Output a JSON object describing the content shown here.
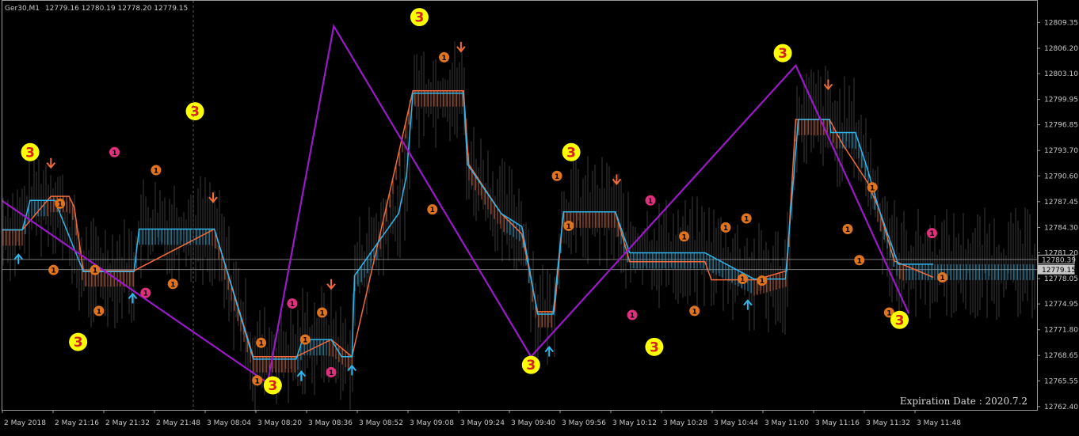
{
  "header": {
    "symbol": "Ger30,M1",
    "ohlc": "12779.16 12780.19 12778.20 12779.15"
  },
  "footer": {
    "expiration": "Expiration Date : 2020.7.2"
  },
  "colors": {
    "background": "#000000",
    "frame": "#9a9a9a",
    "candles": "#3a3a3a",
    "zigzag": "#9a19c8",
    "bull": "#2fb6ec",
    "bear": "#f26b3a",
    "dot_orange": "#e0741e",
    "dot_pink": "#e02f7c",
    "badge_fill": "#ffff00",
    "badge_text": "#d61f1f",
    "price_line": "#7a7a7a"
  },
  "chart_data": {
    "type": "line",
    "x_ticks": [
      "2 May 2018",
      "2 May 21:16",
      "2 May 21:32",
      "2 May 21:48",
      "3 May 08:04",
      "3 May 08:20",
      "3 May 08:36",
      "3 May 08:52",
      "3 May 09:08",
      "3 May 09:24",
      "3 May 09:40",
      "3 May 09:56",
      "3 May 10:12",
      "3 May 10:28",
      "3 May 10:44",
      "3 May 11:00",
      "3 May 11:16",
      "3 May 11:32",
      "3 May 11:48"
    ],
    "y_ticks": [
      12809.35,
      12806.2,
      12803.1,
      12799.95,
      12796.85,
      12793.7,
      12790.6,
      12787.45,
      12784.3,
      12781.2,
      12778.05,
      12774.95,
      12771.8,
      12768.65,
      12765.55,
      12762.4
    ],
    "ylim": [
      12762.0,
      12812.0
    ],
    "markers": [
      {
        "label": "12780.39",
        "value": 12780.39,
        "style": "box"
      },
      {
        "label": "12779.15",
        "value": 12779.15,
        "style": "solid"
      }
    ],
    "zigzag": [
      {
        "x": 0,
        "y": 12787.6
      },
      {
        "x": 20.5,
        "y": 12765.3
      },
      {
        "x": 25.6,
        "y": 12808.9
      },
      {
        "x": 40.8,
        "y": 12768.5
      },
      {
        "x": 61.2,
        "y": 12804.1
      },
      {
        "x": 69.9,
        "y": 12773.8
      }
    ],
    "channel_bull": [
      [
        0,
        12784.0
      ],
      [
        1.6,
        12784.0
      ],
      [
        2.2,
        12787.6
      ],
      [
        3.8,
        12787.6
      ],
      [
        4.1,
        12787.6
      ],
      [
        6.3,
        12778.9
      ],
      [
        10.2,
        12778.9
      ],
      [
        10.6,
        12784.1
      ],
      [
        16.4,
        12784.1
      ],
      [
        19.4,
        12768.2
      ],
      [
        22.7,
        12768.2
      ],
      [
        23.2,
        12770.6
      ],
      [
        25.4,
        12770.6
      ],
      [
        26.2,
        12768.5
      ],
      [
        27.0,
        12768.5
      ],
      [
        27.2,
        12778.4
      ],
      [
        30.6,
        12786.0
      ],
      [
        31.2,
        12790.6
      ],
      [
        31.7,
        12800.7
      ],
      [
        35.6,
        12800.7
      ],
      [
        35.9,
        12792.0
      ],
      [
        38.5,
        12786.0
      ],
      [
        40.1,
        12784.4
      ],
      [
        41.3,
        12773.7
      ],
      [
        42.5,
        12773.7
      ],
      [
        43.3,
        12786.2
      ],
      [
        47.3,
        12786.2
      ],
      [
        48.4,
        12781.2
      ],
      [
        54.2,
        12781.2
      ],
      [
        58.0,
        12778.0
      ],
      [
        60.4,
        12778.0
      ],
      [
        61.4,
        12797.5
      ],
      [
        63.8,
        12797.5
      ],
      [
        63.9,
        12795.9
      ],
      [
        65.8,
        12795.9
      ],
      [
        66.7,
        12791.6
      ],
      [
        67.6,
        12786.6
      ],
      [
        69.1,
        12779.8
      ],
      [
        71.8,
        12779.8
      ]
    ],
    "channel_bear": [
      [
        0,
        12784.0
      ],
      [
        1.6,
        12784.0
      ],
      [
        3.8,
        12788.1
      ],
      [
        5.2,
        12788.1
      ],
      [
        5.6,
        12786.8
      ],
      [
        6.3,
        12779.0
      ],
      [
        10.2,
        12779.0
      ],
      [
        16.4,
        12784.1
      ],
      [
        19.4,
        12768.5
      ],
      [
        22.7,
        12768.5
      ],
      [
        25.4,
        12770.6
      ],
      [
        27.0,
        12768.5
      ],
      [
        31.7,
        12801.0
      ],
      [
        35.6,
        12801.0
      ],
      [
        36.0,
        12792.0
      ],
      [
        38.5,
        12786.0
      ],
      [
        40.1,
        12783.5
      ],
      [
        41.3,
        12774.0
      ],
      [
        42.6,
        12774.0
      ],
      [
        43.3,
        12786.2
      ],
      [
        47.3,
        12786.2
      ],
      [
        48.4,
        12780.1
      ],
      [
        54.2,
        12780.1
      ],
      [
        54.7,
        12777.9
      ],
      [
        58.1,
        12777.9
      ],
      [
        60.5,
        12779.0
      ],
      [
        61.2,
        12797.5
      ],
      [
        63.8,
        12797.5
      ],
      [
        64.8,
        12794.5
      ],
      [
        66.7,
        12789.9
      ],
      [
        67.6,
        12786.6
      ],
      [
        68.8,
        12780.2
      ],
      [
        71.8,
        12778.2
      ]
    ],
    "badges": [
      {
        "text": "3",
        "x": 2.2,
        "y": 12793.5
      },
      {
        "text": "3",
        "x": 5.9,
        "y": 12770.3
      },
      {
        "text": "3",
        "x": 14.9,
        "y": 12798.5
      },
      {
        "text": "3",
        "x": 20.9,
        "y": 12765.0
      },
      {
        "text": "3",
        "x": 32.2,
        "y": 12810.0
      },
      {
        "text": "3",
        "x": 40.8,
        "y": 12767.5
      },
      {
        "text": "3",
        "x": 43.9,
        "y": 12793.5
      },
      {
        "text": "3",
        "x": 50.3,
        "y": 12769.7
      },
      {
        "text": "3",
        "x": 60.2,
        "y": 12805.6
      },
      {
        "text": "3",
        "x": 69.2,
        "y": 12773.0
      }
    ],
    "dots": [
      {
        "text": "1",
        "x": 8.7,
        "y": 12793.5,
        "kind": "pink"
      },
      {
        "text": "1",
        "x": 11.9,
        "y": 12791.3,
        "kind": "orange"
      },
      {
        "text": "1",
        "x": 4.0,
        "y": 12779.1,
        "kind": "orange"
      },
      {
        "text": "1",
        "x": 4.5,
        "y": 12787.2,
        "kind": "orange"
      },
      {
        "text": "1",
        "x": 7.2,
        "y": 12779.1,
        "kind": "orange"
      },
      {
        "text": "1",
        "x": 7.5,
        "y": 12774.1,
        "kind": "orange"
      },
      {
        "text": "1",
        "x": 11.1,
        "y": 12776.3,
        "kind": "pink"
      },
      {
        "text": "1",
        "x": 13.2,
        "y": 12777.4,
        "kind": "orange"
      },
      {
        "text": "1",
        "x": 19.7,
        "y": 12765.6,
        "kind": "orange"
      },
      {
        "text": "1",
        "x": 20.0,
        "y": 12770.2,
        "kind": "orange"
      },
      {
        "text": "1",
        "x": 22.4,
        "y": 12775.0,
        "kind": "pink"
      },
      {
        "text": "1",
        "x": 23.4,
        "y": 12770.6,
        "kind": "orange"
      },
      {
        "text": "1",
        "x": 24.7,
        "y": 12773.9,
        "kind": "orange"
      },
      {
        "text": "1",
        "x": 25.4,
        "y": 12766.6,
        "kind": "pink"
      },
      {
        "text": "1",
        "x": 33.2,
        "y": 12786.5,
        "kind": "orange"
      },
      {
        "text": "1",
        "x": 34.1,
        "y": 12805.1,
        "kind": "orange"
      },
      {
        "text": "1",
        "x": 42.8,
        "y": 12790.6,
        "kind": "orange"
      },
      {
        "text": "1",
        "x": 43.7,
        "y": 12784.5,
        "kind": "orange"
      },
      {
        "text": "1",
        "x": 48.6,
        "y": 12773.6,
        "kind": "pink"
      },
      {
        "text": "1",
        "x": 50.0,
        "y": 12787.6,
        "kind": "pink"
      },
      {
        "text": "1",
        "x": 52.6,
        "y": 12783.2,
        "kind": "orange"
      },
      {
        "text": "1",
        "x": 53.4,
        "y": 12774.1,
        "kind": "orange"
      },
      {
        "text": "1",
        "x": 55.8,
        "y": 12784.3,
        "kind": "orange"
      },
      {
        "text": "1",
        "x": 57.4,
        "y": 12785.4,
        "kind": "orange"
      },
      {
        "text": "1",
        "x": 57.1,
        "y": 12778.0,
        "kind": "orange"
      },
      {
        "text": "1",
        "x": 58.6,
        "y": 12777.8,
        "kind": "orange"
      },
      {
        "text": "1",
        "x": 65.2,
        "y": 12784.1,
        "kind": "orange"
      },
      {
        "text": "1",
        "x": 66.1,
        "y": 12780.3,
        "kind": "orange"
      },
      {
        "text": "1",
        "x": 67.1,
        "y": 12789.2,
        "kind": "orange"
      },
      {
        "text": "1",
        "x": 68.4,
        "y": 12773.9,
        "kind": "orange"
      },
      {
        "text": "1",
        "x": 71.7,
        "y": 12783.6,
        "kind": "pink"
      },
      {
        "text": "1",
        "x": 72.5,
        "y": 12778.2,
        "kind": "orange"
      }
    ],
    "arrows_up": [
      {
        "x": 1.3,
        "y": 12780.4
      },
      {
        "x": 10.1,
        "y": 12775.6
      },
      {
        "x": 23.1,
        "y": 12766.1
      },
      {
        "x": 27.0,
        "y": 12766.8
      },
      {
        "x": 42.2,
        "y": 12769.1
      },
      {
        "x": 57.5,
        "y": 12774.8
      }
    ],
    "arrows_down": [
      {
        "x": 3.8,
        "y": 12792.2
      },
      {
        "x": 16.3,
        "y": 12788.0
      },
      {
        "x": 25.4,
        "y": 12777.4
      },
      {
        "x": 35.4,
        "y": 12806.4
      },
      {
        "x": 47.4,
        "y": 12790.2
      },
      {
        "x": 63.7,
        "y": 12801.8
      }
    ]
  }
}
